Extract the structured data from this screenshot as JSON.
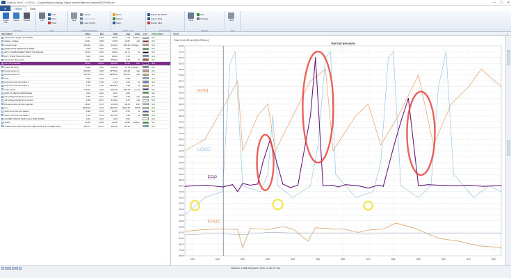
{
  "window": {
    "title": "LiveLink Gen II - v.2.9.4.0 ... \\Logs\\datalog scheppg_12ppsi.new.fuel.filter.maf.cleaned[2023*03].csv",
    "controls": [
      "—",
      "☐",
      "✕"
    ]
  },
  "menu": {
    "file_label": "",
    "tabs": [
      "Home",
      "Tools"
    ],
    "active": "Home"
  },
  "ribbon": {
    "groups": [
      {
        "label": "Settings",
        "big": [
          {
            "label": "Guide\nMe",
            "icon": "guide-icon",
            "color": "#2f6fbf"
          },
          {
            "label": "Game",
            "icon": "game-icon",
            "color": "#3b7ac9"
          },
          {
            "label": "Vehicle",
            "icon": "vehicle-icon",
            "color": "#555a66"
          }
        ]
      },
      {
        "label": "Data",
        "big": [
          {
            "label": "List",
            "icon": "list-icon",
            "color": "#6c7a8e"
          }
        ],
        "small": [
          {
            "label": "Find",
            "icon": "find-icon",
            "color": "#3a66a8"
          },
          {
            "label": "Filter",
            "icon": "filter-icon",
            "color": "#3a66a8"
          },
          {
            "label": "Clear",
            "icon": "clear-icon",
            "color": "#c23a3a"
          }
        ]
      },
      {
        "label": "Chart Navigation",
        "big": [
          {
            "label": "Nav",
            "icon": "nav-icon",
            "color": "#8a96a8"
          }
        ],
        "small": [
          {
            "label": "Layout",
            "icon": "layout-icon",
            "color": "#7c8b9f"
          },
          {
            "label": "Save Config",
            "icon": "save-config-icon",
            "color": "#7c8b9f",
            "disabled": true
          },
          {
            "label": "Load Config",
            "icon": "load-config-icon",
            "color": "#7c8b9f"
          }
        ]
      },
      {
        "label": "Data Logs",
        "big": [],
        "small": [
          {
            "label": "Open",
            "icon": "open-icon",
            "color": "#d6a231"
          },
          {
            "label": "Import",
            "icon": "import-icon",
            "color": "#3b8a3b"
          },
          {
            "label": "Save",
            "icon": "save-icon",
            "color": "#2b5797"
          }
        ]
      },
      {
        "label": "Device Files",
        "big": [],
        "small": [
          {
            "label": "Export DLF2DLV",
            "icon": "export-icon",
            "color": "#2b5797"
          },
          {
            "label": "Import Data",
            "icon": "import-data-icon",
            "color": "#2b5797"
          },
          {
            "label": "Delete Files",
            "icon": "delete-files-icon",
            "color": "#c23a3a"
          }
        ]
      },
      {
        "label": "Display",
        "big": [
          {
            "label": "View",
            "icon": "view-icon",
            "color": "#6a7b91"
          }
        ],
        "small": [
          {
            "label": "Add",
            "icon": "add-icon",
            "color": "#3b8a3b"
          },
          {
            "label": "Settings",
            "icon": "settings-icon",
            "color": "#6a7b91"
          }
        ]
      },
      {
        "label": "Help",
        "big": [
          {
            "label": "Help",
            "icon": "help-icon",
            "color": "#8a96a8"
          }
        ]
      }
    ]
  },
  "params": {
    "columns": [
      "Item Name",
      "Value",
      "Min",
      "Max",
      "Avg",
      "Units",
      "Line",
      "Interpolated"
    ],
    "rows": [
      {
        "name": "Actual cam angle of camshaft",
        "value": "7.10",
        "min": "-1.63",
        "max": "36.00",
        "avg": "3.44",
        "units": "degree",
        "color": "#ffffff",
        "interp": "N/A"
      },
      {
        "name": "battery voltage",
        "value": "13.81",
        "min": "9.88",
        "max": "14.35",
        "avg": "13.82",
        "units": "volt",
        "color": "#c01818",
        "interp": "N/A"
      },
      {
        "name": "coolant temp",
        "value": "208.40",
        "min": "0.62",
        "max": "236.00",
        "avg": "195.40",
        "units": "°F(fahre...",
        "color": "#e0c060",
        "interp": "N/A"
      },
      {
        "name": "EFFECTIVE THROTTLE AREA",
        "value": "0.00",
        "min": "0.00",
        "max": "44.83",
        "avg": "0.08",
        "units": "",
        "color": "#18a018",
        "interp": "N/A"
      },
      {
        "name": "ETC COMMANDED THROTTLE ANGLE",
        "value": "15.00",
        "min": "0.00",
        "max": "28.00",
        "avg": "12.71",
        "units": "%",
        "color": "#111111",
        "interp": "N/A"
      },
      {
        "name": "ETC THROTTLE VACUUM",
        "value": "0.00",
        "min": "0.00",
        "max": "88.00",
        "avg": "3.71",
        "units": "",
        "color": "#3a5fd0",
        "interp": "N/A"
      },
      {
        "name": "fuel pump duty cycle",
        "value": "0.31",
        "min": "0.05",
        "max": "850.00",
        "avg": "0.36",
        "units": "%",
        "color": "#b06020",
        "interp": "N/A"
      },
      {
        "name": "fuel rail pressure",
        "value": "39.53",
        "min": "20.05",
        "max": "465.50",
        "avg": "41.41",
        "units": "PSI",
        "color": "#5a1a6e",
        "interp": "N/A",
        "selected": true
      },
      {
        "name": "intake air temp",
        "value": "73.80",
        "min": "0.00",
        "max": "102.00",
        "avg": "75.79",
        "units": "°F(fahre...",
        "color": "#5a78b0",
        "interp": "N/A"
      },
      {
        "name": "knock sensor 1",
        "value": "603.00",
        "min": "0.00",
        "max": "1375.00",
        "avg": "181.25",
        "units": "volt",
        "color": "#d09090",
        "interp": "N/A"
      },
      {
        "name": "knock sensor 2",
        "value": "357.00",
        "min": "0.00",
        "max": "8000.00",
        "avg": "257.61",
        "units": "volt",
        "color": "#e0a040",
        "interp": "N/A"
      },
      {
        "name": "load",
        "value": "0.56",
        "min": "0.09",
        "max": "1.10",
        "avg": "0.58",
        "units": "",
        "color": "#7ab0e0",
        "interp": "N/A"
      },
      {
        "name": "long term fuel trim bank 1",
        "value": "1.00",
        "min": "1.00",
        "max": "1.01",
        "avg": "1.01",
        "units": "%",
        "color": "#7080c0",
        "interp": "N/A"
      },
      {
        "name": "long term fuel trim bank 2",
        "value": "1.00",
        "min": "1.00",
        "max": "2000.00",
        "avg": "1.26",
        "units": "%",
        "color": "#e0a040",
        "interp": "N/A"
      },
      {
        "name": "mafl counts",
        "value": "775.33",
        "min": "0.00",
        "max": "961.00",
        "avg": "339.76",
        "units": "count",
        "color": "#2030a0",
        "interp": "N/A"
      },
      {
        "name": "MAP AT ZERO AIRCHARGE",
        "value": "0.00",
        "min": "0.00",
        "max": "0.02",
        "avg": "0.00",
        "units": "",
        "color": "#18a018",
        "interp": "N/A"
      },
      {
        "name": "O2 voltage bank1 front sensor",
        "value": "0.46",
        "min": "0.01",
        "max": "0.96",
        "avg": "0.44",
        "units": "volt",
        "color": "#ffffff",
        "interp": "N/A"
      },
      {
        "name": "O2 voltage bank2 front sensor",
        "value": "0.38",
        "min": "-0.01",
        "max": "214.00",
        "avg": "0.47",
        "units": "volt",
        "color": "#ffffff",
        "interp": "N/A"
      },
      {
        "name": "pressure drop across injectors",
        "value": "38.15",
        "min": "0.73",
        "max": "133.59",
        "avg": "38.31",
        "units": "PSI",
        "color": "#ffffff",
        "interp": "N/A"
      },
      {
        "name": "rpm",
        "value": "4890.00",
        "min": "0.00",
        "max": "4363.00",
        "avg": "1809.48",
        "units": "RPM",
        "color": "#ffffff",
        "interp": "N/A"
      },
      {
        "name": "short term fuel trim bank 1",
        "value": "0.98",
        "min": "0.76",
        "max": "84.50",
        "avg": "0.97",
        "units": "%",
        "color": "#5a4ac0",
        "interp": "N/A"
      },
      {
        "name": "short term fuel trim bank 2",
        "value": "1.00",
        "min": "0.70",
        "max": "927.66",
        "avg": "1.28",
        "units": "%",
        "color": "#18a018",
        "interp": "N/A"
      },
      {
        "name": "SLOPE FOR DP MAP CALC IPRC OPEN",
        "value": "0.02",
        "min": "0.02",
        "max": "0.02",
        "avg": "0.02",
        "units": "",
        "color": "#ffffff",
        "interp": "N/A"
      },
      {
        "name": "spark",
        "value": "21.89",
        "min": "-6.00",
        "max": "52.00",
        "avg": "22.89",
        "units": "degree",
        "color": "#18a018",
        "interp": "N/A"
      },
      {
        "name": "THROTTLE POSITION ETC RELATIVE TO CLOSED THR...",
        "value": "209.77",
        "min": "47.87",
        "max": "466.26",
        "avg": "116.19",
        "units": "",
        "color": "#30b8b8",
        "interp": "N/A"
      }
    ]
  },
  "chart": {
    "header": "Chart",
    "close": "×",
    "subtitle": "Time: 8 min 32 sec [512.290 sec]",
    "y_ticks": [
      "62.00",
      "61.00",
      "60.00",
      "59.00",
      "58.00",
      "57.00",
      "56.00",
      "55.00",
      "54.00",
      "53.00",
      "52.00",
      "51.00",
      "50.00",
      "49.00",
      "48.00",
      "47.00",
      "46.00",
      "45.00",
      "44.00",
      "43.00",
      "42.00",
      "41.00",
      "40.00",
      "39.00",
      "38.00",
      "37.00",
      "36.00",
      "35.00",
      "34.00",
      "33.00",
      "32.00",
      "31.00",
      "30.00",
      "29.00",
      "28.00",
      "27.00",
      "26.00"
    ],
    "x_ticks": [
      "500",
      "510",
      "520",
      "530",
      "540",
      "550",
      "560",
      "570",
      "580",
      "590",
      "600",
      "610",
      "620"
    ],
    "annotations": {
      "rpm": "RPM",
      "load": "LOAD",
      "frp": "FRP",
      "fpdc": "FPDC"
    }
  },
  "chart_data": {
    "type": "line",
    "title": "fuel rail pressure",
    "x": [
      497,
      500,
      506,
      512,
      516,
      518,
      520,
      523,
      526,
      528,
      531,
      536,
      539,
      542,
      547,
      549,
      552,
      556,
      558,
      561,
      566,
      570,
      574,
      576,
      580,
      583,
      586,
      590,
      594,
      598,
      604,
      610,
      616,
      620,
      623
    ],
    "xlim": [
      497,
      623
    ],
    "ylim": [
      26,
      62
    ],
    "series": [
      {
        "name": "fuel rail pressure",
        "color": "#6a1b7e",
        "values": [
          37.9,
          38.0,
          38.1,
          37.8,
          38.2,
          37.0,
          38.4,
          38.1,
          38.3,
          42.0,
          46.0,
          38.3,
          37.7,
          38.1,
          50.0,
          60.0,
          38.0,
          38.1,
          37.8,
          38.2,
          38.0,
          37.6,
          38.1,
          37.9,
          44.5,
          49.0,
          53.0,
          38.0,
          38.2,
          38.1,
          38.0,
          38.1,
          37.9,
          38.0,
          38.0
        ]
      }
    ]
  },
  "status": {
    "text": "25 Items, 1,596,000 points, Time 14 min 27 sec"
  }
}
